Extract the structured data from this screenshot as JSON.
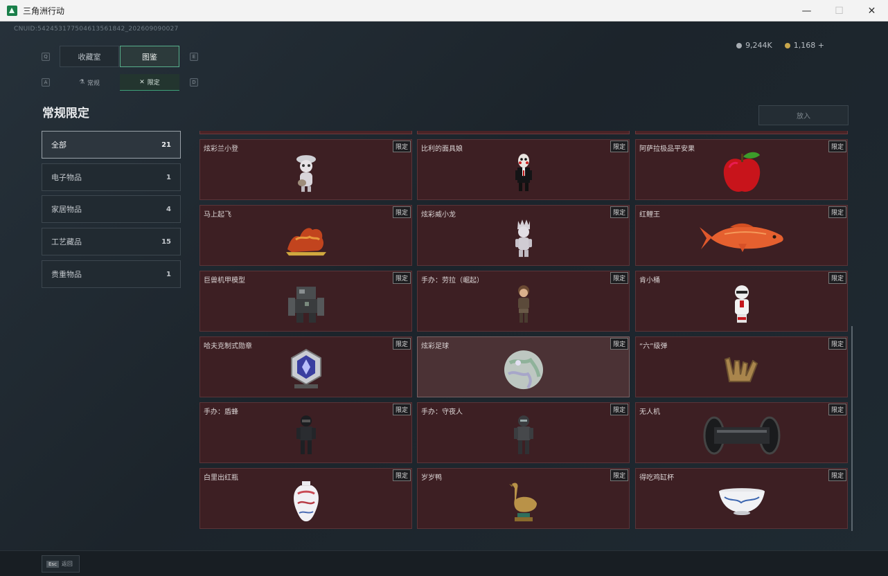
{
  "window": {
    "title": "三角洲行动",
    "minimize": "—",
    "maximize": "☐",
    "close": "✕"
  },
  "header": {
    "uid": "CNUID:542453177504613561842_202609090027",
    "currency": [
      {
        "icon": "silver-coin-icon",
        "value": "9,244K"
      },
      {
        "icon": "gold-coin-icon",
        "value": "1,168 +"
      }
    ]
  },
  "tabs": {
    "main": [
      {
        "label": "收藏室",
        "active": false
      },
      {
        "label": "图鉴",
        "active": true
      }
    ],
    "sub": [
      {
        "label": "常规",
        "icon": "flask-icon",
        "active": false
      },
      {
        "label": "限定",
        "icon": "crossed-icon",
        "active": true
      }
    ],
    "keys": {
      "q": "Q",
      "e": "E",
      "a": "A",
      "d": "D"
    }
  },
  "page_title": "常规限定",
  "deposit_button": "放入",
  "categories": [
    {
      "label": "全部",
      "count": "21",
      "active": true
    },
    {
      "label": "电子物品",
      "count": "1",
      "active": false
    },
    {
      "label": "家居物品",
      "count": "4",
      "active": false
    },
    {
      "label": "工艺藏品",
      "count": "15",
      "active": false
    },
    {
      "label": "贵重物品",
      "count": "1",
      "active": false
    }
  ],
  "tag_label": "限定",
  "items": [
    {
      "name": "炫彩兰小登",
      "icon": "doll-figure-icon"
    },
    {
      "name": "比利的面具娘",
      "icon": "puppet-figure-icon"
    },
    {
      "name": "阿萨拉极品平安果",
      "icon": "apple-icon"
    },
    {
      "name": "马上起飞",
      "icon": "horse-sculpture-icon"
    },
    {
      "name": "炫彩威小龙",
      "icon": "white-figure-icon"
    },
    {
      "name": "红鲤王",
      "icon": "carp-fish-icon"
    },
    {
      "name": "巨兽机甲模型",
      "icon": "mech-model-icon"
    },
    {
      "name": "手办：劳拉（崛起）",
      "icon": "lara-figure-icon"
    },
    {
      "name": "肯小桶",
      "icon": "bucket-figure-icon"
    },
    {
      "name": "哈夫克制式勋章",
      "icon": "medal-icon"
    },
    {
      "name": "炫彩足球",
      "icon": "football-icon"
    },
    {
      "name": "“六”级弹",
      "icon": "hand-gesture-icon"
    },
    {
      "name": "手办：盾蜂",
      "icon": "soldier-figure-icon"
    },
    {
      "name": "手办：守夜人",
      "icon": "nightwatch-figure-icon"
    },
    {
      "name": "无人机",
      "icon": "drone-roller-icon"
    },
    {
      "name": "白里出红瓶",
      "icon": "porcelain-vase-icon"
    },
    {
      "name": "岁岁鸭",
      "icon": "bronze-duck-icon"
    },
    {
      "name": "得吃鸡缸杯",
      "icon": "porcelain-cup-icon"
    }
  ],
  "bottom": {
    "esc_key": "Esc",
    "esc_label": "返回"
  }
}
